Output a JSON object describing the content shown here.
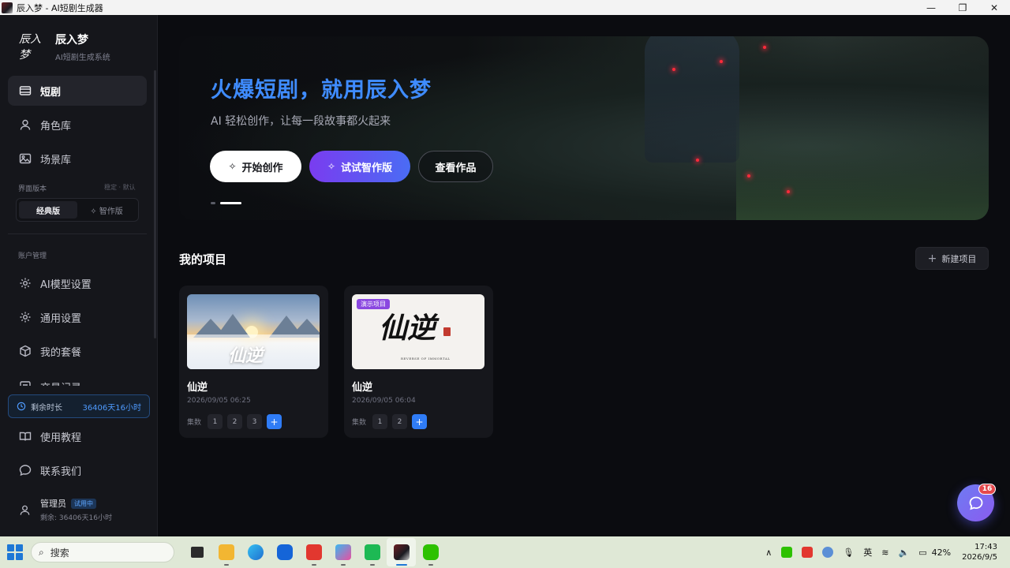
{
  "window": {
    "title": "辰入梦 - AI短剧生成器",
    "minimize": "—",
    "maximize": "❐",
    "close": "✕"
  },
  "brand": {
    "logo": "辰入梦",
    "name": "辰入梦",
    "subtitle": "AI短剧生成系统"
  },
  "nav": {
    "main": [
      {
        "label": "短剧",
        "icon": "film-icon",
        "active": true
      },
      {
        "label": "角色库",
        "icon": "user-icon"
      },
      {
        "label": "场景库",
        "icon": "image-icon"
      }
    ],
    "version": {
      "label": "界面版本",
      "hint": "稳定 · 默认",
      "options": [
        "经典版",
        "✧ 智作版"
      ],
      "selected": "经典版"
    },
    "account_label": "账户管理",
    "account": [
      {
        "label": "AI模型设置",
        "icon": "gear-icon"
      },
      {
        "label": "通用设置",
        "icon": "gear-icon"
      },
      {
        "label": "我的套餐",
        "icon": "box-icon"
      },
      {
        "label": "交易记录",
        "icon": "receipt-icon"
      }
    ],
    "remaining": {
      "label": "剩余时长",
      "value": "36406天16小时"
    },
    "bottom": [
      {
        "label": "使用教程",
        "icon": "book-icon"
      },
      {
        "label": "联系我们",
        "icon": "chat-icon"
      }
    ],
    "user": {
      "name": "管理员",
      "badge": "试用中",
      "sub": "剩余: 36406天16小时"
    }
  },
  "hero": {
    "title": "火爆短剧，就用辰入梦",
    "subtitle": "AI 轻松创作，让每一段故事都火起来",
    "buttons": {
      "start": "开始创作",
      "try": "试试智作版",
      "view": "查看作品"
    }
  },
  "projects": {
    "title": "我的项目",
    "new_button": "新建项目",
    "episodes_label": "集数",
    "items": [
      {
        "name": "仙逆",
        "date": "2026/09/05 06:25",
        "episodes": [
          "1",
          "2",
          "3"
        ],
        "thumb_text": "仙逆"
      },
      {
        "name": "仙逆",
        "date": "2026/09/05 06:04",
        "episodes": [
          "1",
          "2"
        ],
        "demo_tag": "演示项目",
        "thumb_text": "仙逆",
        "thumb_sub": "REVERSE OF IMMORTAL"
      }
    ]
  },
  "fab": {
    "badge": "16"
  },
  "taskbar": {
    "search": "搜索",
    "ime": "英",
    "battery": "42%",
    "time": "17:43",
    "date": "2026/9/5"
  },
  "colors": {
    "accent": "#3f8cff",
    "purple": "#7a3cf0",
    "demo_tag": "#8a47e0",
    "badge": "#e5484d"
  }
}
